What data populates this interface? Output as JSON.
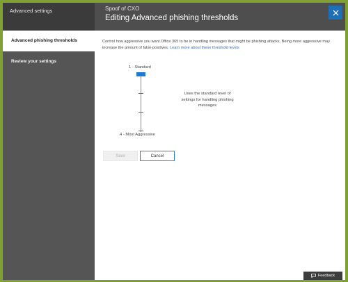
{
  "sidebar": {
    "header": "Advanced settings",
    "items": [
      {
        "label": "Advanced phishing thresholds",
        "active": true
      },
      {
        "label": "Review your settings",
        "active": false
      }
    ]
  },
  "header": {
    "subtitle": "Spoof of CXO",
    "title": "Editing Advanced phishing thresholds",
    "close_icon": "close-icon"
  },
  "description": {
    "text": "Control how aggressive you want Office 365 to be in handling messages that might be phishing attacks. Being more aggressive may increase the amount of false-positives.",
    "link": "Learn more about these threshold levels"
  },
  "slider": {
    "label_top": "1 - Standard",
    "label_bottom": "4 - Most Aggressive",
    "level": 1,
    "levels": 4,
    "level_description": "Uses the standard level of settings for handling phishing messages"
  },
  "buttons": {
    "save": "Save",
    "cancel": "Cancel"
  },
  "feedback": {
    "label": "Feedback",
    "icon": "chat-bubble-icon"
  },
  "colors": {
    "accent": "#1f78d1",
    "sidebar": "#555555",
    "header": "#4e4e4e"
  }
}
